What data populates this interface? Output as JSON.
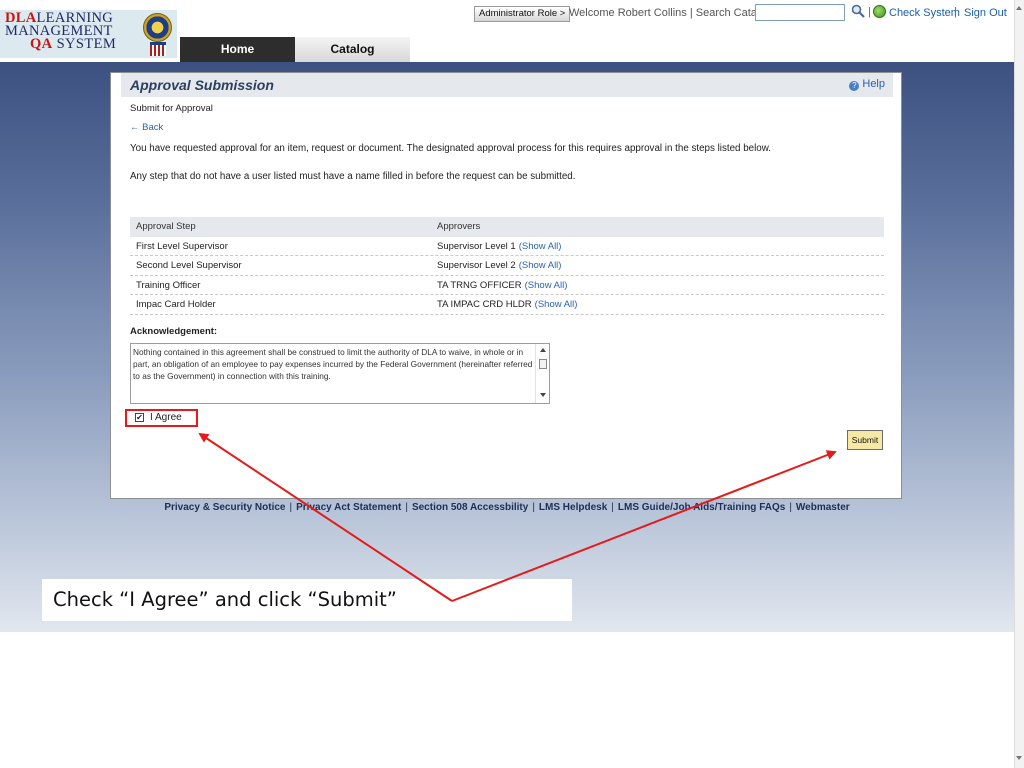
{
  "logo": {
    "line1_red": "DLA",
    "line1_rest": "LEARNING",
    "line2": "MANAGEMENT",
    "line3_qa": "QA",
    "line3_rest": "SYSTEM"
  },
  "nav": {
    "home": "Home",
    "catalog": "Catalog"
  },
  "topbar": {
    "admin_role": "Administrator Role >",
    "welcome": "Welcome Robert Collins | Search Catalog",
    "search_value": "",
    "separator": "|",
    "check_system": "Check System",
    "sign_out": "Sign Out"
  },
  "panel": {
    "title": "Approval Submission",
    "help": "Help",
    "help_icon": "?",
    "subtitle": "Submit for Approval",
    "back": "← Back",
    "info_1": "You have requested approval for an item, request or document. The designated approval process for this requires approval in the steps listed below.",
    "info_2": "Any step that do not have a user listed must have a name filled in before the request can be submitted."
  },
  "table": {
    "headers": [
      "Approval Step",
      "Approvers"
    ],
    "rows": [
      {
        "step": "First Level Supervisor",
        "approver": "Supervisor Level 1",
        "link": "(Show All)"
      },
      {
        "step": "Second Level Supervisor",
        "approver": "Supervisor Level 2",
        "link": "(Show All)"
      },
      {
        "step": "Training Officer",
        "approver": "TA TRNG OFFICER",
        "link": "(Show All)"
      },
      {
        "step": "Impac Card Holder",
        "approver": "TA IMPAC CRD HLDR",
        "link": "(Show All)"
      }
    ]
  },
  "acknowledgement": {
    "label": "Acknowledgement:",
    "text": "Nothing contained in this agreement shall be construed to limit the authority of DLA to waive, in whole or in part, an obligation of an employee to pay expenses incurred by the Federal Government  (hereinafter referred to as the Government) in connection with this training."
  },
  "agree": {
    "checked": true,
    "check_mark": "✔",
    "label": "I Agree"
  },
  "submit": {
    "label": "Submit"
  },
  "footer": {
    "links": [
      "Privacy & Security Notice",
      "Privacy Act Statement",
      "Section 508 Accessbility",
      "LMS Helpdesk",
      "LMS Guide/Job Aids/Training FAQs",
      "Webmaster"
    ],
    "separator": "|"
  },
  "callout": {
    "text": "Check “I Agree” and click “Submit”",
    "arrow_color": "#e31b1b"
  },
  "colors": {
    "highlight_red": "#e31b1b",
    "link_blue": "#2a63b0",
    "submit_yellow": "#f7e8a4",
    "header_band": "#3c5180"
  }
}
